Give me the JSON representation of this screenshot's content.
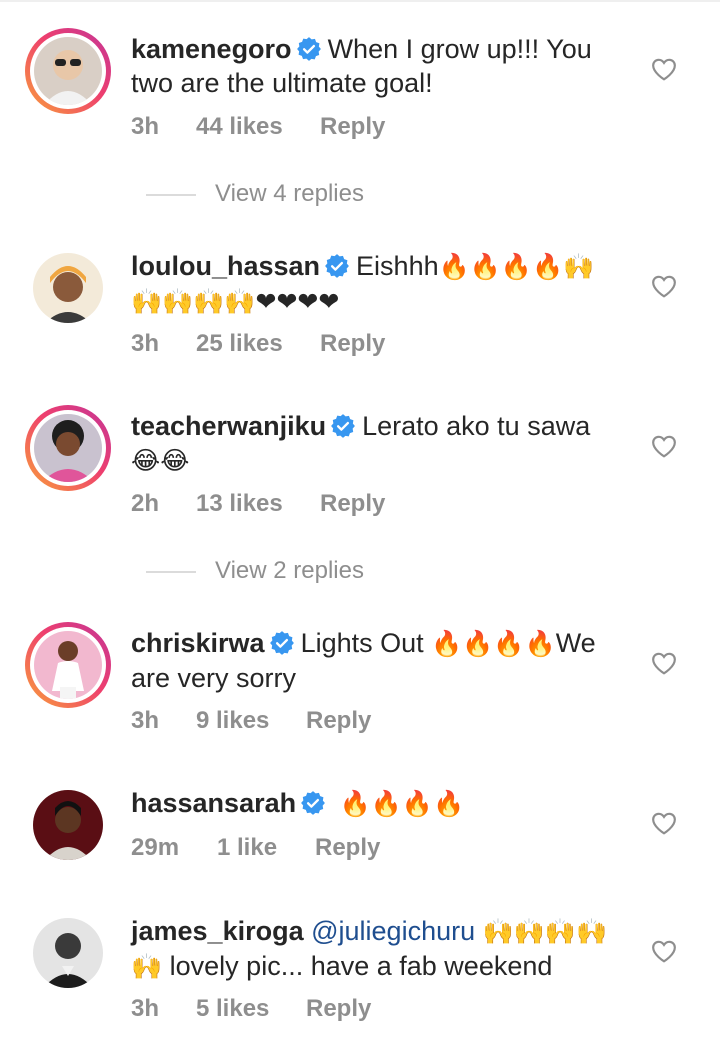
{
  "comments": [
    {
      "username": "kamenegoro",
      "verified": true,
      "text_lines": [
        "When I grow up!!! You",
        "two are the ultimate goal!"
      ],
      "time": "3h",
      "likes": "44 likes",
      "reply_label": "Reply",
      "story_ring": true,
      "view_replies": "View 4 replies"
    },
    {
      "username": "loulou_hassan",
      "verified": true,
      "text_main": "Eishhh",
      "emoji_line1": "🔥🔥🔥🔥🙌",
      "emoji_line2": "🙌🙌🙌🙌❤❤❤❤",
      "time": "3h",
      "likes": "25 likes",
      "reply_label": "Reply",
      "story_ring": false
    },
    {
      "username": "teacherwanjiku",
      "verified": true,
      "text_main": "Lerato ako tu sawa",
      "emoji_line2": "😂😂",
      "time": "2h",
      "likes": "13 likes",
      "reply_label": "Reply",
      "story_ring": true,
      "view_replies": "View 2 replies"
    },
    {
      "username": "chriskirwa",
      "verified": true,
      "text_main": "Lights Out",
      "emoji_line1": "🔥🔥🔥🔥",
      "text_after": "We",
      "text_line2": "are very sorry",
      "time": "3h",
      "likes": "9 likes",
      "reply_label": "Reply",
      "story_ring": true
    },
    {
      "username": "hassansarah",
      "verified": true,
      "emoji_line1": "🔥🔥🔥🔥",
      "time": "29m",
      "likes": "1 like",
      "reply_label": "Reply",
      "story_ring": false
    },
    {
      "username": "james_kiroga",
      "verified": false,
      "mention": "@juliegichuru",
      "emoji_line1": "🙌🙌🙌🙌",
      "emoji_line2": "🙌",
      "text_line2": "lovely pic... have a fab weekend",
      "time": "3h",
      "likes": "5 likes",
      "reply_label": "Reply",
      "story_ring": false
    }
  ],
  "icons": {
    "verified": "verified-badge-icon",
    "like": "heart-outline-icon"
  },
  "colors": {
    "verified": "#3897f0",
    "secondary_text": "#8e8e8e",
    "mention": "#1f4e8f"
  }
}
